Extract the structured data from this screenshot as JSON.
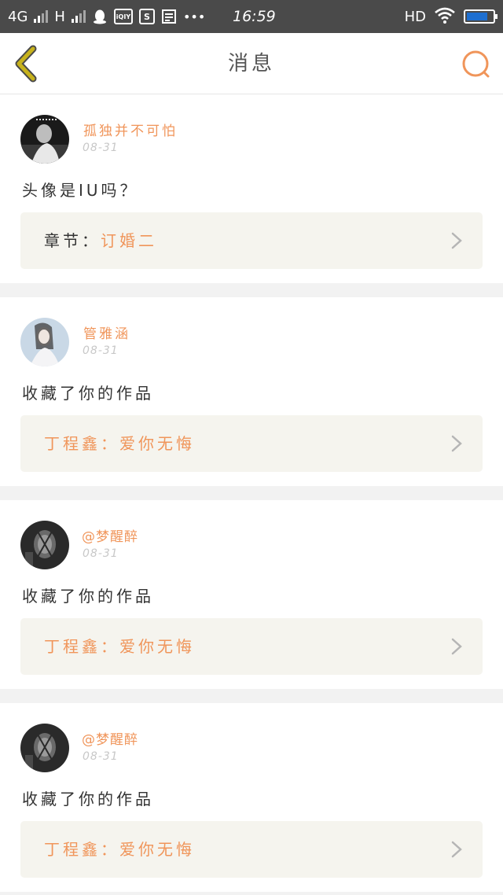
{
  "status_bar": {
    "network_1": "4G",
    "network_2": "H",
    "time": "16:59",
    "hd": "HD",
    "more": "•••",
    "icons": [
      "qq-icon",
      "iqiyi-icon",
      "s-app-icon",
      "weather-app-icon",
      "wifi-icon",
      "battery-icon"
    ]
  },
  "header": {
    "title": "消息"
  },
  "colors": {
    "accent": "#f0955a",
    "back_arrow": "#c7b21b",
    "card_bg": "#f5f4ee"
  },
  "messages": [
    {
      "username": "孤独并不可怕",
      "date": "08-31",
      "content": "头像是IU吗？",
      "ref_label": "章节：",
      "ref_value": "订婚二"
    },
    {
      "username": "管雅涵",
      "date": "08-31",
      "content": "收藏了你的作品",
      "ref_label": "",
      "ref_value": "丁程鑫：爱你无悔"
    },
    {
      "username": "@梦醒醉",
      "date": "08-31",
      "content": "收藏了你的作品",
      "ref_label": "",
      "ref_value": "丁程鑫：爱你无悔"
    },
    {
      "username": "@梦醒醉",
      "date": "08-31",
      "content": "收藏了你的作品",
      "ref_label": "",
      "ref_value": "丁程鑫：爱你无悔"
    }
  ]
}
